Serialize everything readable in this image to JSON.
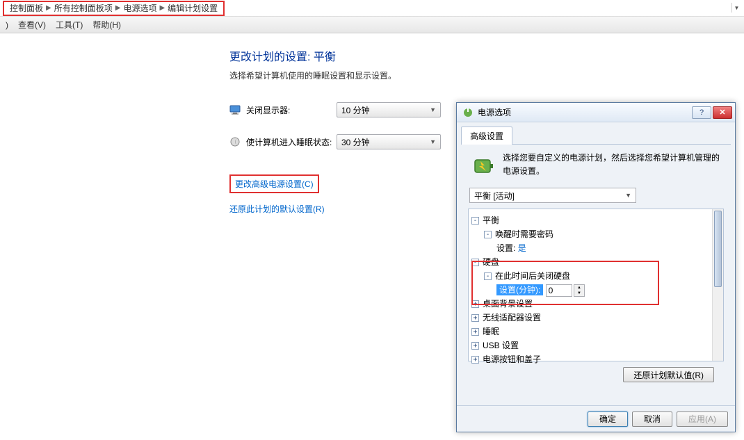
{
  "breadcrumb": {
    "items": [
      "控制面板",
      "所有控制面板项",
      "电源选项",
      "编辑计划设置"
    ]
  },
  "menubar": {
    "items": [
      ")",
      "查看(V)",
      "工具(T)",
      "帮助(H)"
    ]
  },
  "page": {
    "title": "更改计划的设置: 平衡",
    "subtitle": "选择希望计算机使用的睡眠设置和显示设置。"
  },
  "settings": {
    "display_off": {
      "label": "关闭显示器:",
      "value": "10 分钟"
    },
    "sleep": {
      "label": "使计算机进入睡眠状态:",
      "value": "30 分钟"
    }
  },
  "links": {
    "advanced": "更改高级电源设置(C)",
    "restore": "还原此计划的默认设置(R)"
  },
  "dialog": {
    "title": "电源选项",
    "tab": "高级设置",
    "intro": "选择您要自定义的电源计划，然后选择您希望计算机管理的电源设置。",
    "plan_selected": "平衡 [活动]",
    "tree": {
      "balanced": "平衡",
      "wake_password": "唤醒时需要密码",
      "setting_label": "设置:",
      "setting_value": "是",
      "hdd": "硬盘",
      "hdd_off": "在此时间后关闭硬盘",
      "spinner_label": "设置(分钟):",
      "spinner_value": "0",
      "desktop_bg": "桌面背景设置",
      "wireless": "无线适配器设置",
      "sleep_node": "睡眠",
      "usb": "USB 设置",
      "power_button": "电源按钮和盖子"
    },
    "restore_defaults_btn": "还原计划默认值(R)",
    "buttons": {
      "ok": "确定",
      "cancel": "取消",
      "apply": "应用(A)"
    }
  }
}
